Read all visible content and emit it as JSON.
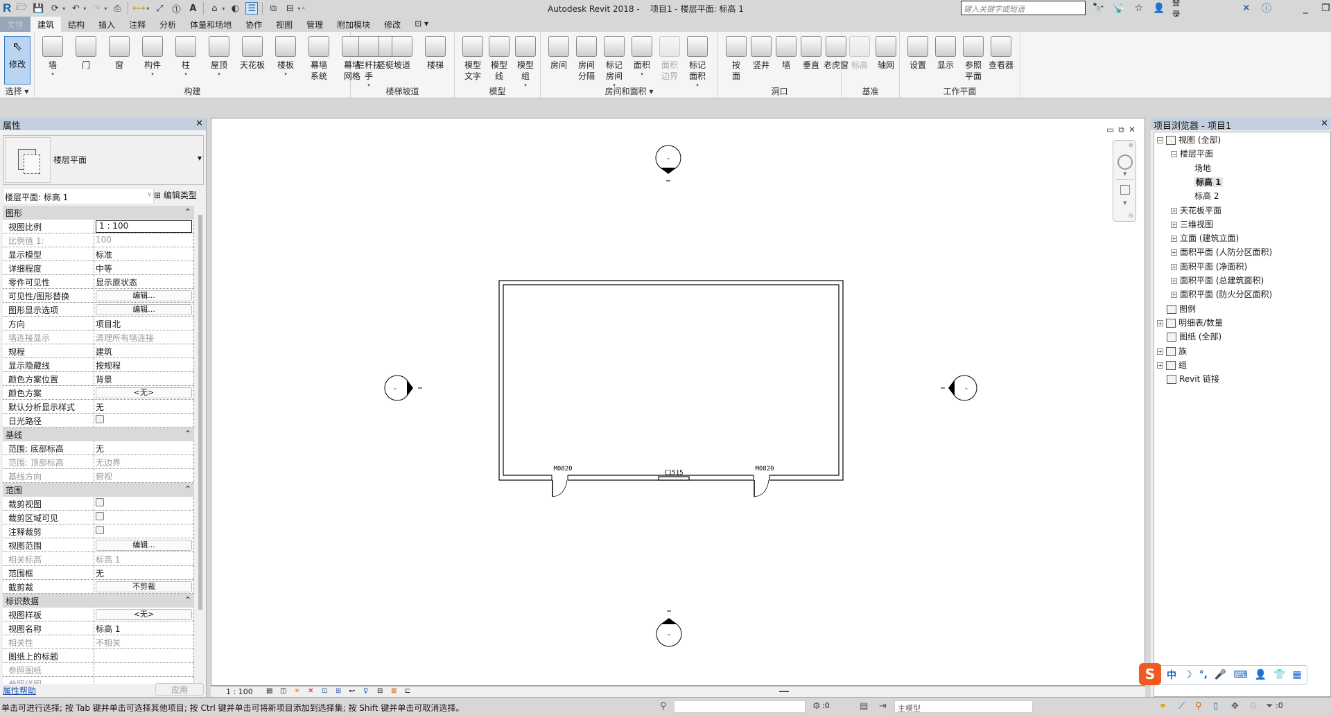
{
  "app": {
    "title": "Autodesk Revit 2018 -",
    "document": "项目1 - 楼层平面: 标高 1",
    "search_placeholder": "键入关键字或短语",
    "login_label": "登录"
  },
  "tabs": [
    {
      "label": "文件",
      "active": false
    },
    {
      "label": "建筑",
      "active": true
    },
    {
      "label": "结构",
      "active": false
    },
    {
      "label": "插入",
      "active": false
    },
    {
      "label": "注释",
      "active": false
    },
    {
      "label": "分析",
      "active": false
    },
    {
      "label": "体量和场地",
      "active": false
    },
    {
      "label": "协作",
      "active": false
    },
    {
      "label": "视图",
      "active": false
    },
    {
      "label": "管理",
      "active": false
    },
    {
      "label": "附加模块",
      "active": false
    },
    {
      "label": "修改",
      "active": false
    }
  ],
  "ribbon": {
    "select": {
      "label": "选择",
      "modify": "修改"
    },
    "build": {
      "label": "构建",
      "buttons": [
        "墙",
        "门",
        "窗",
        "构件",
        "柱",
        "屋顶",
        "天花板",
        "楼板",
        "幕墙\n系统",
        "幕墙\n网格",
        "竖梃"
      ]
    },
    "stairs": {
      "label": "楼梯坡道",
      "buttons": [
        "栏杆扶手",
        "坡道",
        "楼梯"
      ]
    },
    "model": {
      "label": "模型",
      "buttons": [
        "模型\n文字",
        "模型\n线",
        "模型\n组"
      ]
    },
    "room_area": {
      "label": "房间和面积",
      "buttons": [
        "房间",
        "房间\n分隔",
        "标记\n房间",
        "面积",
        "面积\n边界",
        "标记\n面积"
      ]
    },
    "opening": {
      "label": "洞口",
      "buttons": [
        "按\n面",
        "竖井",
        "墙",
        "垂直",
        "老虎窗"
      ]
    },
    "datum": {
      "label": "基准",
      "buttons": [
        "标高",
        "轴网"
      ]
    },
    "workplane": {
      "label": "工作平面",
      "buttons": [
        "设置",
        "显示",
        "参照\n平面",
        "查看器"
      ]
    }
  },
  "properties": {
    "title": "属性",
    "type_name": "楼层平面",
    "instance": "楼层平面: 标高 1",
    "edit_type": "编辑类型",
    "groups": [
      {
        "name": "图形",
        "rows": [
          {
            "k": "视图比例",
            "v": "1 : 100",
            "kind": "input"
          },
          {
            "k": "比例值 1:",
            "v": "100",
            "ro": true
          },
          {
            "k": "显示模型",
            "v": "标准"
          },
          {
            "k": "详细程度",
            "v": "中等"
          },
          {
            "k": "零件可见性",
            "v": "显示原状态"
          },
          {
            "k": "可见性/图形替换",
            "v": "编辑...",
            "kind": "button"
          },
          {
            "k": "图形显示选项",
            "v": "编辑...",
            "kind": "button"
          },
          {
            "k": "方向",
            "v": "项目北"
          },
          {
            "k": "墙连接显示",
            "v": "清理所有墙连接",
            "ro": true
          },
          {
            "k": "规程",
            "v": "建筑"
          },
          {
            "k": "显示隐藏线",
            "v": "按规程"
          },
          {
            "k": "颜色方案位置",
            "v": "背景"
          },
          {
            "k": "颜色方案",
            "v": "<无>",
            "kind": "button"
          },
          {
            "k": "默认分析显示样式",
            "v": "无"
          },
          {
            "k": "日光路径",
            "v": "",
            "kind": "checkbox"
          }
        ]
      },
      {
        "name": "基线",
        "rows": [
          {
            "k": "范围: 底部标高",
            "v": "无"
          },
          {
            "k": "范围: 顶部标高",
            "v": "无边界",
            "ro": true
          },
          {
            "k": "基线方向",
            "v": "俯视",
            "ro": true
          }
        ]
      },
      {
        "name": "范围",
        "rows": [
          {
            "k": "裁剪视图",
            "v": "",
            "kind": "checkbox"
          },
          {
            "k": "裁剪区域可见",
            "v": "",
            "kind": "checkbox"
          },
          {
            "k": "注释裁剪",
            "v": "",
            "kind": "checkbox"
          },
          {
            "k": "视图范围",
            "v": "编辑...",
            "kind": "button"
          },
          {
            "k": "相关标高",
            "v": "标高 1",
            "ro": true
          },
          {
            "k": "范围框",
            "v": "无"
          },
          {
            "k": "截剪裁",
            "v": "不剪裁",
            "kind": "button"
          }
        ]
      },
      {
        "name": "标识数据",
        "rows": [
          {
            "k": "视图样板",
            "v": "<无>",
            "kind": "button"
          },
          {
            "k": "视图名称",
            "v": "标高 1"
          },
          {
            "k": "相关性",
            "v": "不相关",
            "ro": true
          },
          {
            "k": "图纸上的标题",
            "v": ""
          },
          {
            "k": "参照图纸",
            "v": "",
            "ro": true
          },
          {
            "k": "参照详图",
            "v": "",
            "ro": true
          }
        ]
      }
    ],
    "help": "属性帮助",
    "apply": "应用"
  },
  "drawing": {
    "door_tags": [
      "M0820",
      "M0820"
    ],
    "window_tag": "C1515",
    "elevation_marks": [
      "-",
      "-",
      "-",
      "-"
    ]
  },
  "view_bar": {
    "scale": "1 : 100"
  },
  "browser": {
    "title": "项目浏览器 - 项目1",
    "items": [
      {
        "label": "视图 (全部)",
        "level": 0,
        "exp": "−",
        "icon": true
      },
      {
        "label": "楼层平面",
        "level": 1,
        "exp": "−"
      },
      {
        "label": "场地",
        "level": 2
      },
      {
        "label": "标高 1",
        "level": 2,
        "selected": true
      },
      {
        "label": "标高 2",
        "level": 2
      },
      {
        "label": "天花板平面",
        "level": 1,
        "exp": "+"
      },
      {
        "label": "三维视图",
        "level": 1,
        "exp": "+"
      },
      {
        "label": "立面 (建筑立面)",
        "level": 1,
        "exp": "+"
      },
      {
        "label": "面积平面 (人防分区面积)",
        "level": 1,
        "exp": "+"
      },
      {
        "label": "面积平面 (净面积)",
        "level": 1,
        "exp": "+"
      },
      {
        "label": "面积平面 (总建筑面积)",
        "level": 1,
        "exp": "+"
      },
      {
        "label": "面积平面 (防火分区面积)",
        "level": 1,
        "exp": "+"
      },
      {
        "label": "图例",
        "level": 0,
        "icon": true
      },
      {
        "label": "明细表/数量",
        "level": 0,
        "exp": "+",
        "icon": true
      },
      {
        "label": "图纸 (全部)",
        "level": 0,
        "icon": true
      },
      {
        "label": "族",
        "level": 0,
        "exp": "+",
        "icon": true
      },
      {
        "label": "组",
        "level": 0,
        "exp": "+",
        "icon": true
      },
      {
        "label": "Revit 链接",
        "level": 0,
        "icon": true
      }
    ]
  },
  "ime": {
    "items": [
      "中",
      "☽",
      "°,",
      "🎤",
      "⌨",
      "👤",
      "👕",
      "▦"
    ]
  },
  "status": {
    "text": "单击可进行选择; 按 Tab 键并单击可选择其他项目; 按 Ctrl 键并单击可将新项目添加到选择集; 按 Shift 键并单击可取消选择。",
    "selection_count": ":0",
    "model": "主模型",
    "filter_count": ":0"
  }
}
